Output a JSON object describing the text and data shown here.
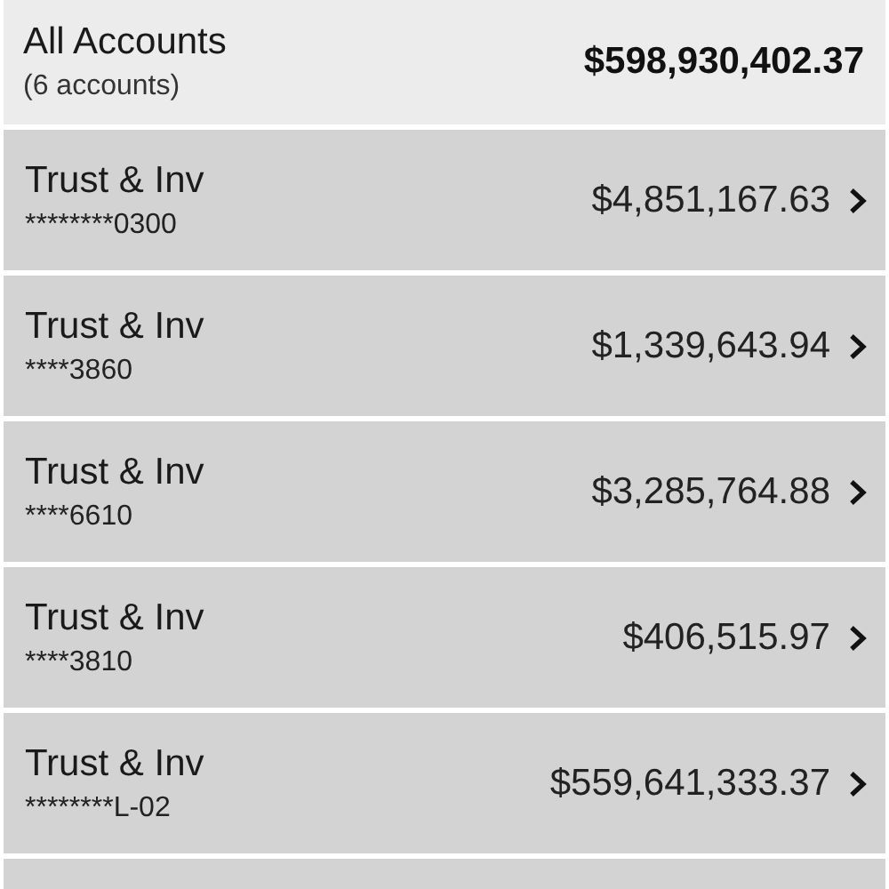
{
  "summary": {
    "title": "All Accounts",
    "subtitle": "(6 accounts)",
    "total": "$598,930,402.37"
  },
  "accounts": [
    {
      "name": "Trust & Inv",
      "number": "********0300",
      "balance": "$4,851,167.63"
    },
    {
      "name": "Trust & Inv",
      "number": "****3860",
      "balance": "$1,339,643.94"
    },
    {
      "name": "Trust & Inv",
      "number": "****6610",
      "balance": "$3,285,764.88"
    },
    {
      "name": "Trust & Inv",
      "number": "****3810",
      "balance": "$406,515.97"
    },
    {
      "name": "Trust & Inv",
      "number": "********L-02",
      "balance": "$559,641,333.37"
    }
  ]
}
